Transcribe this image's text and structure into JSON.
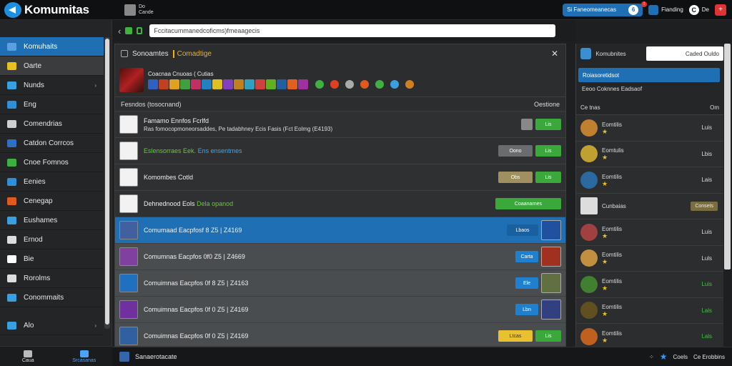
{
  "topbar": {
    "app_name": "Komumitas",
    "user_line1": "Do",
    "user_line2": "Cande",
    "search_text": "Si Faneomeanecas",
    "search_badge": "!",
    "btn_fianding": "Fianding",
    "btn_de": "De",
    "btn_plus": "+"
  },
  "sidebar": {
    "items": [
      {
        "label": "Komuhaits",
        "color": "#5aa0e0",
        "active": true
      },
      {
        "label": "Oarte",
        "color": "#e8c020",
        "hover": true
      },
      {
        "label": "Nunds",
        "color": "#3a9fe0",
        "chev": "›"
      },
      {
        "label": "Eng",
        "color": "#2f8fd8"
      },
      {
        "label": "Comendrias",
        "color": "#cfcfcf"
      },
      {
        "label": "Catdon Corrcos",
        "color": "#3070c0"
      },
      {
        "label": "Cnoe Fomnos",
        "color": "#3cb040"
      },
      {
        "label": "Eenies",
        "color": "#2f8fd8"
      },
      {
        "label": "Cenegap",
        "color": "#e05a20"
      },
      {
        "label": "Eushames",
        "color": "#3a9fe0"
      },
      {
        "label": "Ernod",
        "color": "#dddddd"
      },
      {
        "label": "Bie",
        "color": "#ffffff"
      },
      {
        "label": "Rorolms",
        "color": "#dddddd"
      },
      {
        "label": "Conommaits",
        "color": "#3a9fe0"
      },
      {
        "label": "Alo",
        "color": "#3a9fe0",
        "chev": "›"
      }
    ],
    "bottom": [
      {
        "label": "Caua"
      },
      {
        "label": "Srcasanas",
        "on": true
      }
    ]
  },
  "address": {
    "back": "‹",
    "forward": "›",
    "url": "Fccitacummanedcoficms)fmeaagecis"
  },
  "panel": {
    "title": "Sonoamtes",
    "tag": "Comadtige",
    "close": "✕",
    "hero_name": "Coacnaa Cnuoas ( Cutias",
    "hero_icons": [
      "#3060c0",
      "#c04020",
      "#e0a020",
      "#40a040",
      "#c03060",
      "#2080c0",
      "#e0c020",
      "#8040c0",
      "#c08020",
      "#30a0c0",
      "#d04040",
      "#60b020",
      "#2060a0",
      "#e06020",
      "#a030a0"
    ],
    "tail_icons": [
      "#40b040",
      "#e04020",
      "#aaaaaa",
      "#e05a20",
      "#40b040",
      "#3a9fe0",
      "#d08020"
    ],
    "col_left": "Fesndos (tosocnand)",
    "col_right": "Oestione",
    "rows": [
      {
        "title": "Famamo Ennfos Fcrlfd",
        "sub": "Ras fomocopmoneorsaddes, Pe tadabhney Ecis Fasis (Fct Eolmg (E4193)",
        "style": "",
        "thumb": "white",
        "btn1": "",
        "btn1_class": "small",
        "btn2": "Lis",
        "btn2_class": "green"
      },
      {
        "title": "Eslensorraes Eek.",
        "title2": "Ens ensentmes",
        "sub": "",
        "style": "",
        "thumb": "white",
        "title_class": "green-txt",
        "btn1": "Oono",
        "btn1_class": "gray",
        "btn2": "Lis",
        "btn2_class": "green"
      },
      {
        "title": "Komombes Cotld",
        "sub": "",
        "style": "",
        "thumb": "white",
        "btn1": "Obs",
        "btn1_class": "tan",
        "btn2": "Lis",
        "btn2_class": "green"
      },
      {
        "title": "Dehnednood Eols",
        "title2": "Dela opanod",
        "sub": "",
        "style": "",
        "thumb": "white",
        "title2_class": "green-txt",
        "btn1": "Coaanarnes",
        "btn1_class": "wide",
        "btn2": "",
        "btn2_class": ""
      },
      {
        "title": "Comumaad Eacpfosf 8 Z5 | Z4169",
        "sub": "",
        "style": "sel",
        "thumb": "#4060a0",
        "btn1": "Lbaos",
        "btn1_class": "blue2",
        "btn2": "",
        "btn2_class": "",
        "rthumb": "#2050a0"
      },
      {
        "title": "Comumnas Eacpfos 0f0 Z5 | Z4669",
        "sub": "",
        "style": "light",
        "thumb": "#8040a0",
        "btn1": "Carta",
        "btn1_class": "blue",
        "btn2": "",
        "btn2_class": "",
        "rthumb": "#a03020"
      },
      {
        "title": "Comuimnas Eacpfos 0f 8 Z5 | Z4163",
        "sub": "",
        "style": "light",
        "thumb": "#2070c0",
        "btn1": "Ele",
        "btn1_class": "blue",
        "btn2": "",
        "btn2_class": "",
        "rthumb": "#607040"
      },
      {
        "title": "Comuimnas Eacpfos 0f 0 Z5 | Z4169",
        "sub": "",
        "style": "light",
        "thumb": "#7030a0",
        "btn1": "Lbn",
        "btn1_class": "blue",
        "btn2": "",
        "btn2_class": "",
        "rthumb": "#304080"
      },
      {
        "title": "Comuimnas Eacpfos 0f 0 Z5 | Z4169",
        "sub": "",
        "style": "light",
        "thumb": "#3060a0",
        "btn1": "Ltcas",
        "btn1_class": "yellow",
        "btn2": "Lis",
        "btn2_class": "green",
        "rthumb": ""
      }
    ]
  },
  "rpanel": {
    "label": "Komubnites",
    "input": "Caded Ouldo",
    "blue": "Roiasoretidsot",
    "sub": "Eeoo Coknnes Eadsaof",
    "col_left": "Ce tnas",
    "col_right": "Om",
    "rows": [
      {
        "name": "Eomtilis",
        "val": "Luis",
        "green": false,
        "img": "#c08030"
      },
      {
        "name": "Eomtulis",
        "val": "Lbis",
        "green": false,
        "img": "#c0a030"
      },
      {
        "name": "Eomtilis",
        "val": "Lais",
        "green": false,
        "img": "#2a6aa0"
      },
      {
        "name": "Cunbaias",
        "val": "Consets",
        "btn": true,
        "img": "#dddddd"
      },
      {
        "name": "Eomtilis",
        "val": "Luis",
        "green": false,
        "img": "#a04040"
      },
      {
        "name": "Eomtilis",
        "val": "Luls",
        "green": false,
        "img": "#c09040"
      },
      {
        "name": "Eomtilis",
        "val": "Luis",
        "green": true,
        "img": "#408030"
      },
      {
        "name": "Eomtilis",
        "val": "Lals",
        "green": true,
        "img": "#605020"
      },
      {
        "name": "Eomtilis",
        "val": "Lals",
        "green": true,
        "img": "#c06020"
      }
    ]
  },
  "bottombar": {
    "left": "Sanaerotacate",
    "middle": "Coels",
    "right": "Ce Erobbins"
  }
}
